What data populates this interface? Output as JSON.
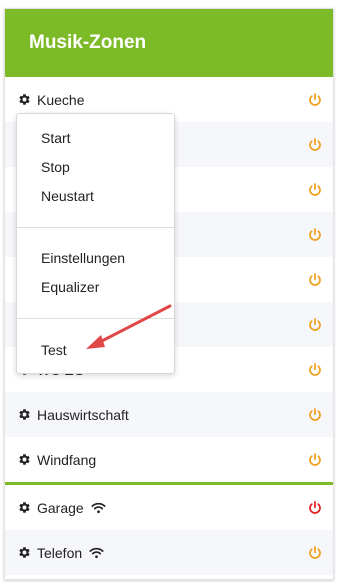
{
  "header": {
    "title": "Musik-Zonen"
  },
  "zones": [
    {
      "label": "Kueche",
      "power_color": "#f0a020"
    },
    {
      "label": "",
      "power_color": "#f0a020"
    },
    {
      "label": "",
      "power_color": "#f0a020"
    },
    {
      "label": "",
      "power_color": "#f0a020"
    },
    {
      "label": "",
      "power_color": "#f0a020"
    },
    {
      "label": "",
      "power_color": "#f0a020"
    },
    {
      "label": "WC EG",
      "power_color": "#f0a020"
    },
    {
      "label": "Hauswirtschaft",
      "power_color": "#f0a020"
    },
    {
      "label": "Windfang",
      "power_color": "#f0a020"
    }
  ],
  "group_zones": [
    {
      "label": "Garage",
      "wifi": true,
      "power_color": "#e02020"
    },
    {
      "label": "Telefon",
      "wifi": true,
      "power_color": "#f0a020"
    }
  ],
  "context_menu": {
    "items_top": [
      "Start",
      "Stop",
      "Neustart"
    ],
    "items_mid": [
      "Einstellungen",
      "Equalizer"
    ],
    "items_bottom": [
      "Test"
    ]
  },
  "colors": {
    "accent": "#7cba28",
    "arrow": "#e04848"
  }
}
